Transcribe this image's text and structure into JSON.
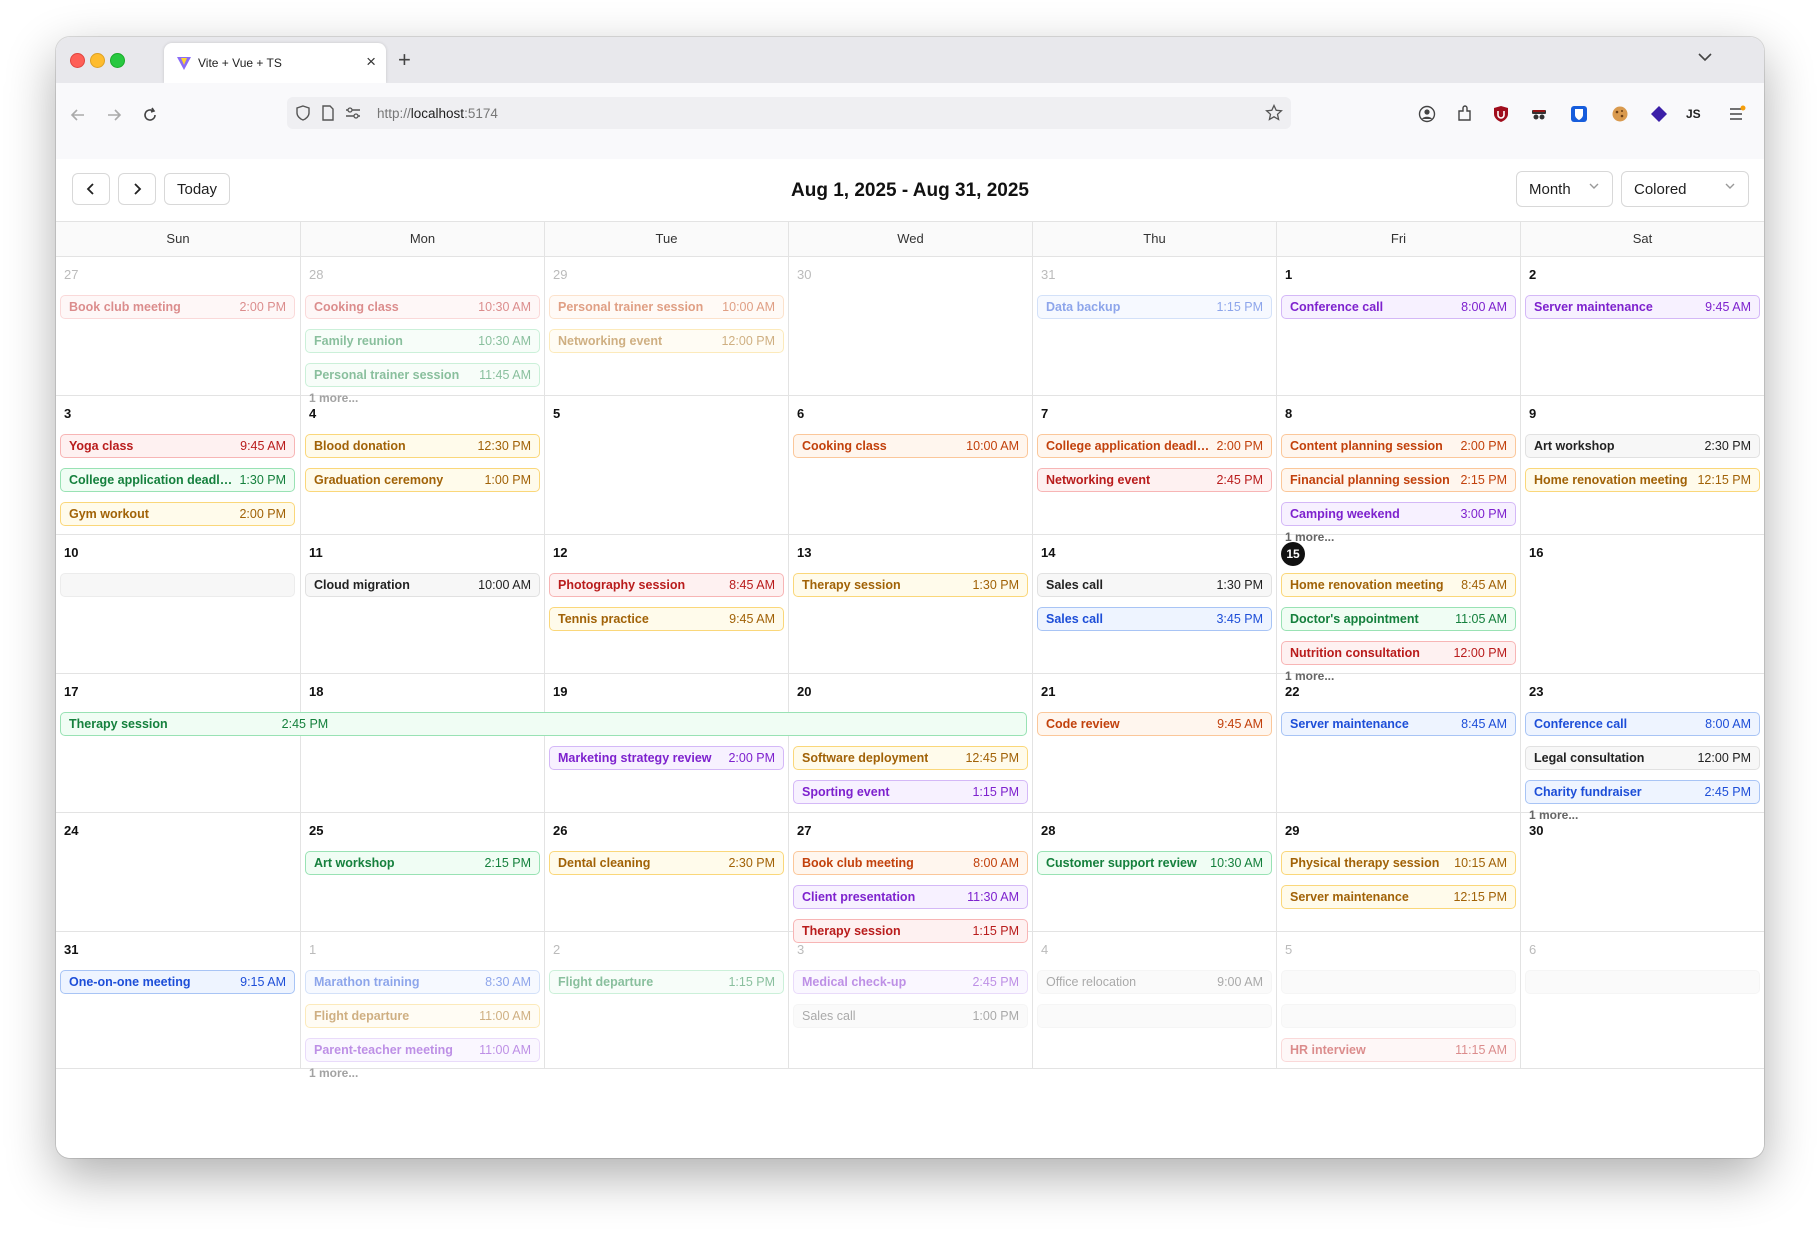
{
  "browser": {
    "tab_title": "Vite + Vue + TS",
    "url_scheme": "http://",
    "url_host": "localhost",
    "url_port": ":5174",
    "profile_label": "JS"
  },
  "toolbar": {
    "prev_label": "<",
    "next_label": ">",
    "today_label": "Today",
    "range_title": "Aug 1, 2025 - Aug 31, 2025",
    "view_select": "Month",
    "style_select": "Colored"
  },
  "weekdays": [
    "Sun",
    "Mon",
    "Tue",
    "Wed",
    "Thu",
    "Fri",
    "Sat"
  ],
  "weeks": [
    [
      {
        "day": "27",
        "out": true,
        "events": [
          {
            "title": "Book club meeting",
            "time": "2:00 PM",
            "color": "red"
          }
        ]
      },
      {
        "day": "28",
        "out": true,
        "events": [
          {
            "title": "Cooking class",
            "time": "10:30 AM",
            "color": "red"
          },
          {
            "title": "Family reunion",
            "time": "10:30 AM",
            "color": "green"
          },
          {
            "title": "Personal trainer session",
            "time": "11:45 AM",
            "color": "green"
          }
        ],
        "more": "1 more..."
      },
      {
        "day": "29",
        "out": true,
        "events": [
          {
            "title": "Personal trainer session",
            "time": "10:00 AM",
            "color": "orange"
          },
          {
            "title": "Networking event",
            "time": "12:00 PM",
            "color": "amber"
          }
        ]
      },
      {
        "day": "30",
        "out": true,
        "events": []
      },
      {
        "day": "31",
        "out": true,
        "events": [
          {
            "title": "Data backup",
            "time": "1:15 PM",
            "color": "blue"
          }
        ]
      },
      {
        "day": "1",
        "events": [
          {
            "title": "Conference call",
            "time": "8:00 AM",
            "color": "purple"
          }
        ]
      },
      {
        "day": "2",
        "events": [
          {
            "title": "Server maintenance",
            "time": "9:45 AM",
            "color": "purple"
          }
        ]
      }
    ],
    [
      {
        "day": "3",
        "events": [
          {
            "title": "Yoga class",
            "time": "9:45 AM",
            "color": "red"
          },
          {
            "title": "College application deadli...",
            "time": "1:30 PM",
            "color": "green"
          },
          {
            "title": "Gym workout",
            "time": "2:00 PM",
            "color": "amber"
          }
        ]
      },
      {
        "day": "4",
        "events": [
          {
            "title": "Blood donation",
            "time": "12:30 PM",
            "color": "amber"
          },
          {
            "title": "Graduation ceremony",
            "time": "1:00 PM",
            "color": "amber"
          }
        ]
      },
      {
        "day": "5",
        "events": []
      },
      {
        "day": "6",
        "events": [
          {
            "title": "Cooking class",
            "time": "10:00 AM",
            "color": "orange"
          }
        ]
      },
      {
        "day": "7",
        "events": [
          {
            "title": "College application deadli...",
            "time": "2:00 PM",
            "color": "orange"
          },
          {
            "title": "Networking event",
            "time": "2:45 PM",
            "color": "red"
          }
        ]
      },
      {
        "day": "8",
        "events": [
          {
            "title": "Content planning session",
            "time": "2:00 PM",
            "color": "orange"
          },
          {
            "title": "Financial planning session",
            "time": "2:15 PM",
            "color": "orange"
          },
          {
            "title": "Camping weekend",
            "time": "3:00 PM",
            "color": "purple"
          }
        ],
        "more": "1 more..."
      },
      {
        "day": "9",
        "events": [
          {
            "title": "Art workshop",
            "time": "2:30 PM",
            "color": "gray"
          },
          {
            "title": "Home renovation meeting",
            "time": "12:15 PM",
            "color": "amber"
          }
        ]
      }
    ],
    [
      {
        "day": "10",
        "events": [
          {
            "title": "",
            "time": "",
            "color": "lgray"
          }
        ]
      },
      {
        "day": "11",
        "events": [
          {
            "title": "Cloud migration",
            "time": "10:00 AM",
            "color": "gray"
          }
        ]
      },
      {
        "day": "12",
        "events": [
          {
            "title": "Photography session",
            "time": "8:45 AM",
            "color": "red"
          },
          {
            "title": "Tennis practice",
            "time": "9:45 AM",
            "color": "amber"
          }
        ]
      },
      {
        "day": "13",
        "events": [
          {
            "title": "Therapy session",
            "time": "1:30 PM",
            "color": "amber"
          }
        ]
      },
      {
        "day": "14",
        "events": [
          {
            "title": "Sales call",
            "time": "1:30 PM",
            "color": "gray"
          },
          {
            "title": "Sales call",
            "time": "3:45 PM",
            "color": "blue"
          }
        ]
      },
      {
        "day": "15",
        "today": true,
        "events": [
          {
            "title": "Home renovation meeting",
            "time": "8:45 AM",
            "color": "amber"
          },
          {
            "title": "Doctor's appointment",
            "time": "11:05 AM",
            "color": "green"
          },
          {
            "title": "Nutrition consultation",
            "time": "12:00 PM",
            "color": "red"
          }
        ],
        "more": "1 more..."
      },
      {
        "day": "16",
        "events": []
      }
    ],
    [
      {
        "day": "17",
        "events": [
          {
            "title": "Therapy session",
            "time": "2:45 PM",
            "color": "green",
            "span": 4
          }
        ]
      },
      {
        "day": "18",
        "events": []
      },
      {
        "day": "19",
        "events": [
          {
            "skip": true
          },
          {
            "title": "Marketing strategy review",
            "time": "2:00 PM",
            "color": "purple"
          }
        ]
      },
      {
        "day": "20",
        "events": [
          {
            "skip": true
          },
          {
            "title": "Software deployment",
            "time": "12:45 PM",
            "color": "amber"
          },
          {
            "title": "Sporting event",
            "time": "1:15 PM",
            "color": "purple"
          }
        ]
      },
      {
        "day": "21",
        "events": [
          {
            "title": "Code review",
            "time": "9:45 AM",
            "color": "orange"
          }
        ]
      },
      {
        "day": "22",
        "events": [
          {
            "title": "Server maintenance",
            "time": "8:45 AM",
            "color": "blue"
          }
        ]
      },
      {
        "day": "23",
        "events": [
          {
            "title": "Conference call",
            "time": "8:00 AM",
            "color": "blue"
          },
          {
            "title": "Legal consultation",
            "time": "12:00 PM",
            "color": "gray"
          },
          {
            "title": "Charity fundraiser",
            "time": "2:45 PM",
            "color": "blue"
          }
        ],
        "more": "1 more..."
      }
    ],
    [
      {
        "day": "24",
        "events": []
      },
      {
        "day": "25",
        "events": [
          {
            "title": "Art workshop",
            "time": "2:15 PM",
            "color": "green"
          }
        ]
      },
      {
        "day": "26",
        "events": [
          {
            "title": "Dental cleaning",
            "time": "2:30 PM",
            "color": "amber"
          }
        ]
      },
      {
        "day": "27",
        "events": [
          {
            "title": "Book club meeting",
            "time": "8:00 AM",
            "color": "orange"
          },
          {
            "title": "Client presentation",
            "time": "11:30 AM",
            "color": "purple"
          },
          {
            "title": "Therapy session",
            "time": "1:15 PM",
            "color": "red"
          }
        ]
      },
      {
        "day": "28",
        "events": [
          {
            "title": "Customer support review",
            "time": "10:30 AM",
            "color": "green"
          }
        ]
      },
      {
        "day": "29",
        "events": [
          {
            "title": "Physical therapy session",
            "time": "10:15 AM",
            "color": "amber"
          },
          {
            "title": "Server maintenance",
            "time": "12:15 PM",
            "color": "amber"
          }
        ]
      },
      {
        "day": "30",
        "events": []
      }
    ],
    [
      {
        "day": "31",
        "events": [
          {
            "title": "One-on-one meeting",
            "time": "9:15 AM",
            "color": "blue"
          }
        ]
      },
      {
        "day": "1",
        "out": true,
        "events": [
          {
            "title": "Marathon training",
            "time": "8:30 AM",
            "color": "blue"
          },
          {
            "title": "Flight departure",
            "time": "11:00 AM",
            "color": "amber"
          },
          {
            "title": "Parent-teacher meeting",
            "time": "11:00 AM",
            "color": "purple"
          }
        ],
        "more": "1 more..."
      },
      {
        "day": "2",
        "out": true,
        "events": [
          {
            "title": "Flight departure",
            "time": "1:15 PM",
            "color": "green"
          }
        ]
      },
      {
        "day": "3",
        "out": true,
        "events": [
          {
            "title": "Medical check-up",
            "time": "2:45 PM",
            "color": "purple"
          },
          {
            "title": "Sales call",
            "time": "1:00 PM",
            "color": "lgray"
          }
        ]
      },
      {
        "day": "4",
        "out": true,
        "events": [
          {
            "title": "Office relocation",
            "time": "9:00 AM",
            "color": "lgray"
          },
          {
            "title": "",
            "time": "",
            "color": "lgray"
          }
        ]
      },
      {
        "day": "5",
        "out": true,
        "events": [
          {
            "title": "",
            "time": "",
            "color": "lgray"
          },
          {
            "title": "",
            "time": "",
            "color": "lgray"
          },
          {
            "title": "HR interview",
            "time": "11:15 AM",
            "color": "red"
          }
        ]
      },
      {
        "day": "6",
        "out": true,
        "events": [
          {
            "title": "",
            "time": "",
            "color": "lgray"
          }
        ]
      }
    ]
  ]
}
